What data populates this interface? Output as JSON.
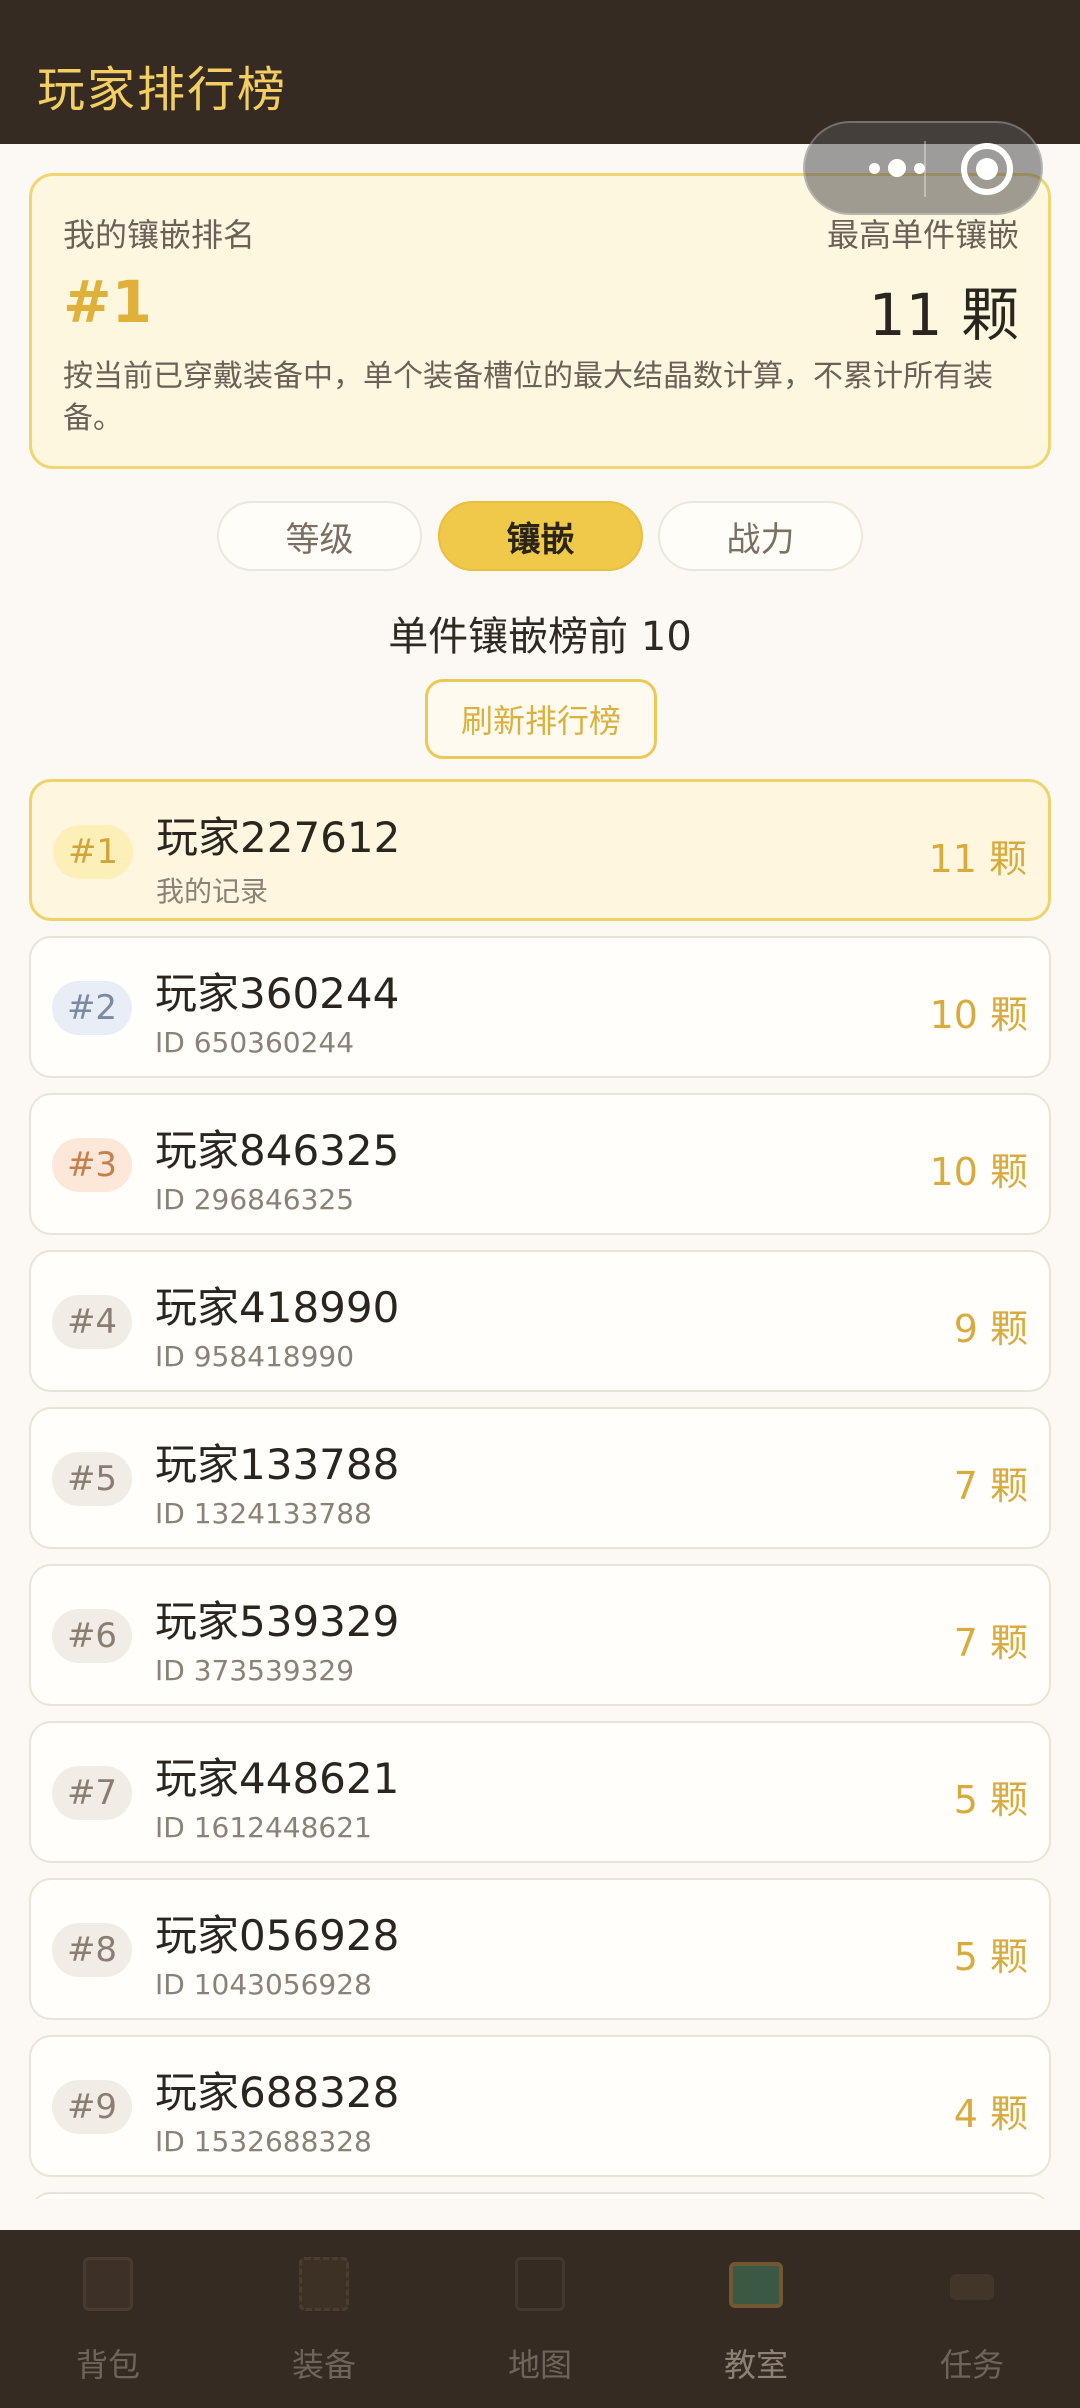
{
  "header": {
    "title": "玩家排行榜"
  },
  "my_rank": {
    "label": "我的镶嵌排名",
    "rank": "#1",
    "max_label": "最高单件镶嵌",
    "max_value": "11 颗",
    "note": "按当前已穿戴装备中，单个装备槽位的最大结晶数计算，不累计所有装备。"
  },
  "tabs": [
    {
      "label": "等级",
      "active": false
    },
    {
      "label": "镶嵌",
      "active": true
    },
    {
      "label": "战力",
      "active": false
    }
  ],
  "section_title": "单件镶嵌榜前 10",
  "refresh_label": "刷新排行榜",
  "rows": [
    {
      "rank": "#1",
      "name": "玩家227612",
      "sub": "我的记录",
      "count": "11 颗"
    },
    {
      "rank": "#2",
      "name": "玩家360244",
      "sub": "ID 650360244",
      "count": "10 颗"
    },
    {
      "rank": "#3",
      "name": "玩家846325",
      "sub": "ID 296846325",
      "count": "10 颗"
    },
    {
      "rank": "#4",
      "name": "玩家418990",
      "sub": "ID 958418990",
      "count": "9 颗"
    },
    {
      "rank": "#5",
      "name": "玩家133788",
      "sub": "ID 1324133788",
      "count": "7 颗"
    },
    {
      "rank": "#6",
      "name": "玩家539329",
      "sub": "ID 373539329",
      "count": "7 颗"
    },
    {
      "rank": "#7",
      "name": "玩家448621",
      "sub": "ID 1612448621",
      "count": "5 颗"
    },
    {
      "rank": "#8",
      "name": "玩家056928",
      "sub": "ID 1043056928",
      "count": "5 颗"
    },
    {
      "rank": "#9",
      "name": "玩家688328",
      "sub": "ID 1532688328",
      "count": "4 颗"
    }
  ],
  "bottom_nav": [
    {
      "label": "背包",
      "icon": "backpack-icon"
    },
    {
      "label": "装备",
      "icon": "equipment-icon"
    },
    {
      "label": "地图",
      "icon": "map-icon"
    },
    {
      "label": "教室",
      "icon": "classroom-icon"
    },
    {
      "label": "任务",
      "icon": "task-icon"
    }
  ],
  "colors": {
    "header_bg": "#362b22",
    "accent_gold": "#f0c94a",
    "title_gold": "#f3cf63",
    "page_bg": "#fcf8f3"
  }
}
